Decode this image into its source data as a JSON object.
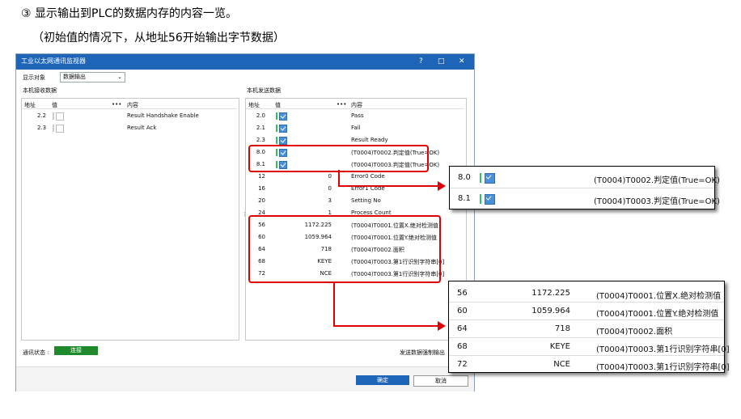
{
  "captions": {
    "line1": "③ 显示输出到PLC的数据内存的内容一览。",
    "line2": "（初始值的情况下，从地址56开始输出字节数据）"
  },
  "window": {
    "title": "工业以太网通讯监视器",
    "help_glyph": "?",
    "maximize_glyph": "□",
    "close_glyph": "✕",
    "display_target_label": "显示对象",
    "display_target_value": "数据输出",
    "receive_section": "本机接收数据",
    "send_section": "本机发送数据",
    "col_address": "地址",
    "col_value": "值",
    "col_more": "•••",
    "col_content": "内容",
    "receive_rows": [
      {
        "address": "2.2",
        "content": "Result Handshake Enable"
      },
      {
        "address": "2.3",
        "content": "Result Ack"
      }
    ],
    "send_rows": [
      {
        "address": "2.0",
        "kind": "check",
        "content": "Pass"
      },
      {
        "address": "2.1",
        "kind": "check",
        "content": "Fail"
      },
      {
        "address": "2.3",
        "kind": "check",
        "content": "Result Ready"
      },
      {
        "address": "8.0",
        "kind": "check",
        "content": "(T0004)T0002.判定值(True=OK)"
      },
      {
        "address": "8.1",
        "kind": "check",
        "content": "(T0004)T0003.判定值(True=OK)"
      },
      {
        "address": "12",
        "kind": "value",
        "value": "0",
        "content": "Error0 Code"
      },
      {
        "address": "16",
        "kind": "value",
        "value": "0",
        "content": "Error1 Code"
      },
      {
        "address": "20",
        "kind": "value",
        "value": "3",
        "content": "Setting No"
      },
      {
        "address": "24",
        "kind": "value",
        "value": "1",
        "content": "Process Count"
      },
      {
        "address": "56",
        "kind": "value",
        "value": "1172.225",
        "content": "(T0004)T0001.位置X.绝对检测值"
      },
      {
        "address": "60",
        "kind": "value",
        "value": "1059.964",
        "content": "(T0004)T0001.位置Y.绝对检测值"
      },
      {
        "address": "64",
        "kind": "value",
        "value": "718",
        "content": "(T0004)T0002.面积"
      },
      {
        "address": "68",
        "kind": "value",
        "value": "KEYE",
        "content": "(T0004)T0003.第1行识别字符串[0]"
      },
      {
        "address": "72",
        "kind": "value",
        "value": "NCE",
        "content": "(T0004)T0003.第1行识别字符串[0]"
      }
    ],
    "comm_status_label": "通讯状态 :",
    "comm_status_value": "连接",
    "send_control_label": "发送数据强制输出",
    "ok_button": "确定",
    "cancel_button": "取消"
  },
  "zoom_bits": [
    {
      "address": "8.0",
      "content": "(T0004)T0002.判定值(True=OK)"
    },
    {
      "address": "8.1",
      "content": "(T0004)T0003.判定值(True=OK)"
    }
  ],
  "zoom_values": [
    {
      "address": "56",
      "value": "1172.225",
      "content": "(T0004)T0001.位置X.绝对检测值"
    },
    {
      "address": "60",
      "value": "1059.964",
      "content": "(T0004)T0001.位置Y.绝对检测值"
    },
    {
      "address": "64",
      "value": "718",
      "content": "(T0004)T0002.面积"
    },
    {
      "address": "68",
      "value": "KEYE",
      "content": "(T0004)T0003.第1行识别字符串[0]"
    },
    {
      "address": "72",
      "value": "NCE",
      "content": "(T0004)T0003.第1行识别字符串[0]"
    }
  ],
  "colors": {
    "titlebar": "#1e65b8",
    "highlight": "#e00000",
    "connected": "#1f8a2c",
    "bit_indicator": "#22c55e"
  }
}
